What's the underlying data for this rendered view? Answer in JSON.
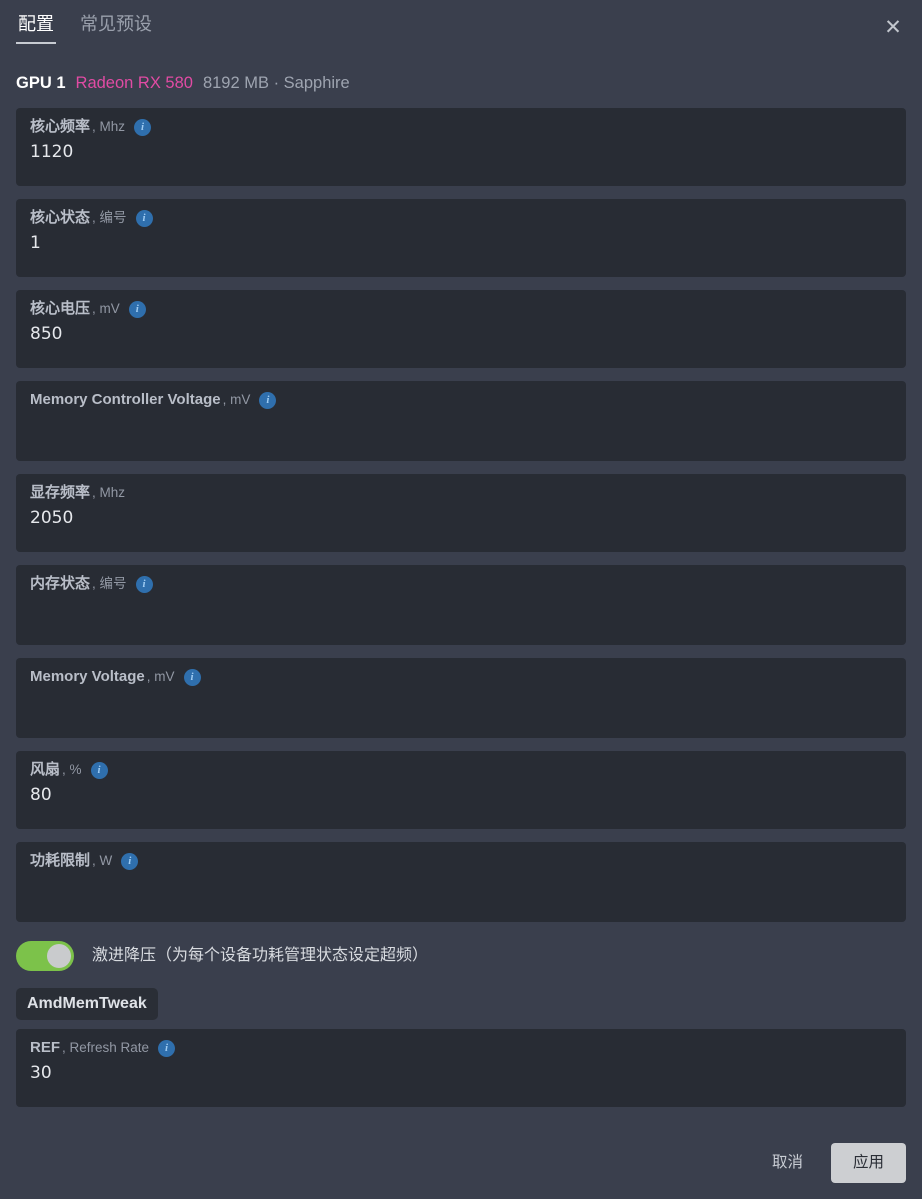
{
  "tabs": [
    {
      "label": "配置",
      "active": true
    },
    {
      "label": "常见预设",
      "active": false
    }
  ],
  "close_icon": "close-icon",
  "close_glyph": "✕",
  "gpu": {
    "index": "GPU 1",
    "model": "Radeon RX 580",
    "meta": "8192 MB · Sapphire"
  },
  "info_glyph": "i",
  "fields": [
    {
      "name": "核心频率",
      "unit": ", Mhz",
      "info": true,
      "value": "1120"
    },
    {
      "name": "核心状态",
      "unit": ", 编号",
      "info": true,
      "value": "1"
    },
    {
      "name": "核心电压",
      "unit": ", mV",
      "info": true,
      "value": "850"
    },
    {
      "name": "Memory Controller Voltage",
      "unit": ", mV",
      "info": true,
      "value": ""
    },
    {
      "name": "显存频率",
      "unit": ", Mhz",
      "info": false,
      "value": "2050"
    },
    {
      "name": "内存状态",
      "unit": ", 编号",
      "info": true,
      "value": ""
    },
    {
      "name": "Memory Voltage",
      "unit": ", mV",
      "info": true,
      "value": ""
    },
    {
      "name": "风扇",
      "unit": ", %",
      "info": true,
      "value": "80"
    },
    {
      "name": "功耗限制",
      "unit": ", W",
      "info": true,
      "value": ""
    }
  ],
  "toggle": {
    "label": "激进降压（为每个设备功耗管理状态设定超频）",
    "on": true
  },
  "section": {
    "badge": "AmdMemTweak",
    "fields": [
      {
        "name": "REF",
        "unit": ", Refresh Rate",
        "info": true,
        "value": "30"
      }
    ]
  },
  "footer": {
    "cancel_label": "取消",
    "apply_label": "应用"
  },
  "colors": {
    "panel_bg": "#3a3f4d",
    "field_bg": "#282c34",
    "accent_model": "#e14ba4",
    "toggle_on": "#7cc24a",
    "info_badge": "#2f6fad",
    "apply_bg": "#cdcfd2"
  }
}
